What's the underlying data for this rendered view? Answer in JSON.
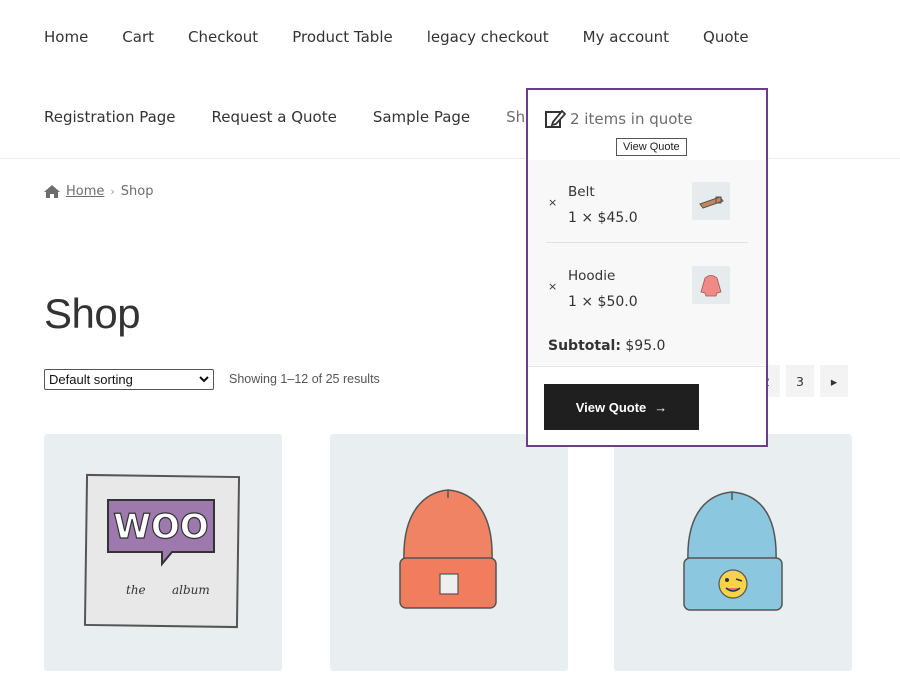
{
  "nav": {
    "row1": [
      "Home",
      "Cart",
      "Checkout",
      "Product Table",
      "legacy checkout",
      "My account",
      "Quote"
    ],
    "row2": [
      "Registration Page",
      "Request a Quote",
      "Sample Page",
      "Shop"
    ]
  },
  "breadcrumb": {
    "home": "Home",
    "separator": "›",
    "current": "Shop"
  },
  "page": {
    "title": "Shop"
  },
  "toolbar": {
    "sorting_value": "Default sorting",
    "result_count": "Showing 1–12 of 25 results"
  },
  "pagination": {
    "pages": [
      "2",
      "3"
    ],
    "next": "▸"
  },
  "quote": {
    "header_label": "2 items in quote",
    "tooltip": "View Quote",
    "items": [
      {
        "remove": "×",
        "name": "Belt",
        "price": "1 × $45.0",
        "thumb_icon": "belt-icon"
      },
      {
        "remove": "×",
        "name": "Hoodie",
        "price": "1 × $50.0",
        "thumb_icon": "hoodie-icon"
      }
    ],
    "subtotal_label": "Subtotal:",
    "subtotal_value": "$95.0",
    "button_label": "View Quote",
    "button_arrow": "→"
  },
  "products": [
    {
      "image": "woo-album-cover",
      "logo_text": "WOO",
      "caption_left": "the",
      "caption_right": "album"
    },
    {
      "image": "orange-beanie"
    },
    {
      "image": "blue-beanie-with-emoji"
    }
  ],
  "colors": {
    "accent_border": "#6b3d8e",
    "button_bg": "#1f1f1f",
    "product_bg": "#e9eef1"
  }
}
